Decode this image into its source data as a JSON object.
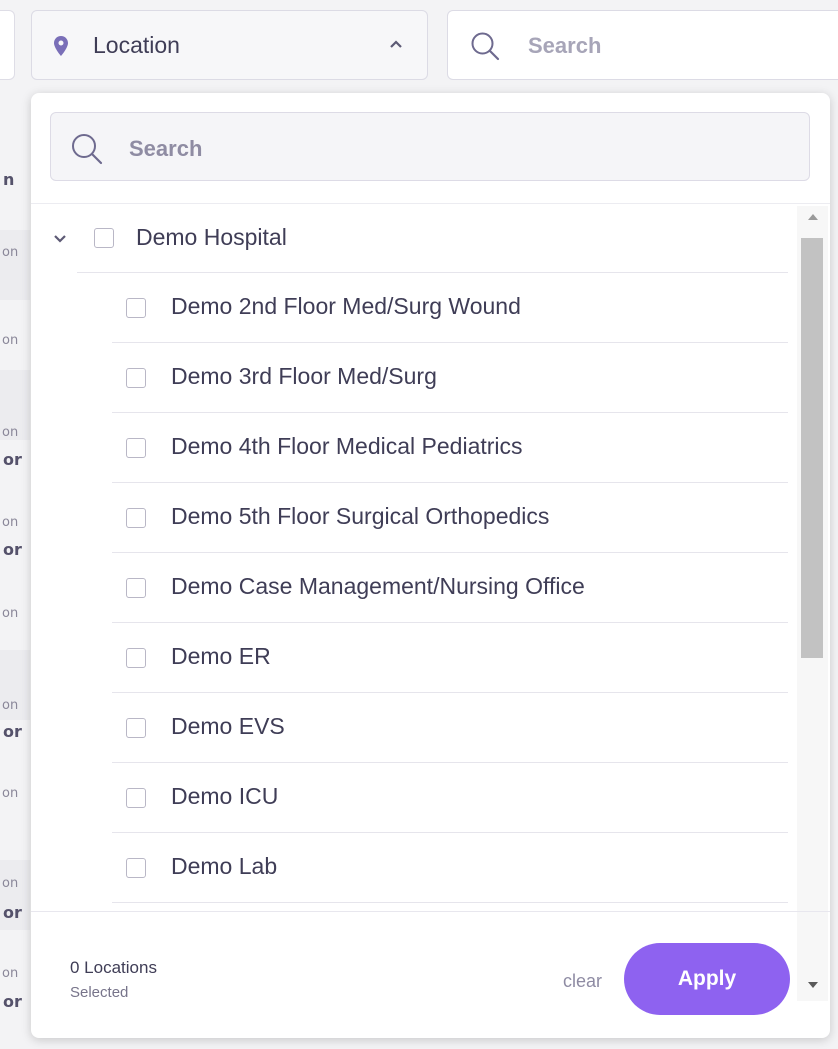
{
  "colors": {
    "accent": "#8e62f0",
    "text_primary": "#3f3d56",
    "placeholder": "#a7a5b8",
    "pin_icon": "#7a6fb8"
  },
  "background_fragments": [
    "n",
    "on",
    "on",
    "on",
    "or",
    "on",
    "or",
    "on",
    "on",
    "or",
    "on",
    "on",
    "or",
    "on",
    "or"
  ],
  "location_select": {
    "label": "Location",
    "icon": "map-pin-icon",
    "state_icon": "chevron-up-icon"
  },
  "top_search": {
    "placeholder": "Search",
    "icon": "search-icon"
  },
  "dropdown": {
    "search": {
      "placeholder": "Search",
      "icon": "search-icon"
    },
    "tree": {
      "root": {
        "label": "Demo Hospital",
        "checked": false,
        "expanded": true
      },
      "children": [
        {
          "label": "Demo 2nd Floor Med/Surg Wound",
          "checked": false
        },
        {
          "label": "Demo 3rd Floor Med/Surg",
          "checked": false
        },
        {
          "label": "Demo 4th Floor Medical Pediatrics",
          "checked": false
        },
        {
          "label": "Demo 5th Floor Surgical Orthopedics",
          "checked": false
        },
        {
          "label": "Demo Case Management/Nursing Office",
          "checked": false
        },
        {
          "label": "Demo ER",
          "checked": false
        },
        {
          "label": "Demo EVS",
          "checked": false
        },
        {
          "label": "Demo ICU",
          "checked": false
        },
        {
          "label": "Demo Lab",
          "checked": false
        }
      ]
    },
    "footer": {
      "count_text": "0 Locations",
      "selected_text": "Selected",
      "clear_label": "clear",
      "apply_label": "Apply"
    }
  }
}
